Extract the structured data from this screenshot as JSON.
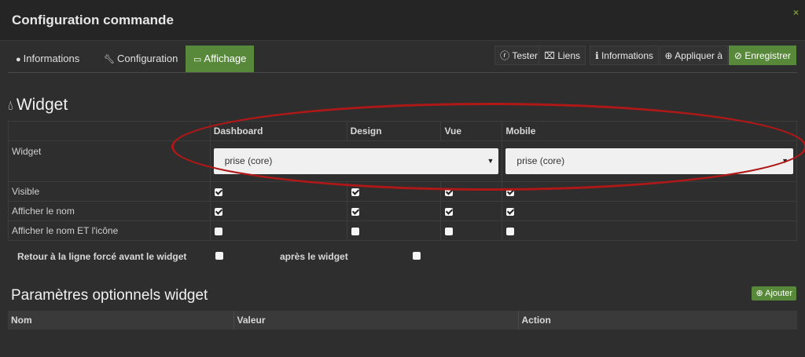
{
  "window": {
    "title": "Configuration commande",
    "close_icon": "×"
  },
  "tabs": [
    {
      "label": "Informations",
      "icon": "info-circle-icon",
      "active": false
    },
    {
      "label": "Configuration",
      "icon": "wrench-icon",
      "active": false
    },
    {
      "label": "Affichage",
      "icon": "monitor-icon",
      "active": true
    }
  ],
  "actions": [
    {
      "label": "Tester",
      "icon": "rss-icon"
    },
    {
      "label": "Liens",
      "icon": "link-frame-icon"
    },
    {
      "label": "Informations",
      "icon": "info-icon"
    },
    {
      "label": "Appliquer à",
      "icon": "plus-circle-icon"
    },
    {
      "label": "Enregistrer",
      "icon": "check-circle-icon"
    }
  ],
  "widget_section": {
    "title": "Widget",
    "columns": [
      "Dashboard",
      "Design",
      "Vue",
      "Mobile"
    ],
    "widget_row": {
      "label": "Widget",
      "dashboard_value": "prise (core)",
      "mobile_value": "prise (core)"
    },
    "rows": [
      {
        "label": "Visible",
        "values": [
          true,
          true,
          true,
          true
        ]
      },
      {
        "label": "Afficher le nom",
        "values": [
          true,
          true,
          true,
          true
        ]
      },
      {
        "label": "Afficher le nom ET l'icône",
        "values": [
          false,
          false,
          false,
          false
        ]
      }
    ],
    "line_break_before": {
      "label": "Retour à la ligne forcé avant le widget",
      "checked": false
    },
    "line_break_after": {
      "label": "après le widget",
      "checked": false
    }
  },
  "params_section": {
    "title": "Paramètres optionnels widget",
    "add_label": "Ajouter",
    "columns": [
      "Nom",
      "Valeur",
      "Action"
    ]
  },
  "colors": {
    "accent": "#58883a",
    "background": "#2e2e2e",
    "annotation": "#b01818"
  }
}
